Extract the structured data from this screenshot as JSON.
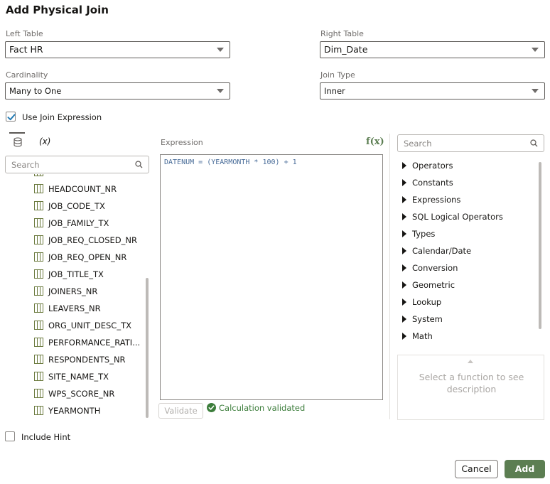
{
  "dialog": {
    "title": "Add Physical Join"
  },
  "left_table": {
    "label": "Left Table",
    "value": "Fact HR"
  },
  "right_table": {
    "label": "Right Table",
    "value": "Dim_Date"
  },
  "cardinality": {
    "label": "Cardinality",
    "value": "Many to One"
  },
  "join_type": {
    "label": "Join Type",
    "value": "Inner"
  },
  "use_join_expression": {
    "label": "Use Join Expression",
    "checked": true
  },
  "left_panel": {
    "variables_tab_label": "(x)",
    "search_placeholder": "Search",
    "columns": [
      "HEADCOUNT_NR",
      "JOB_CODE_TX",
      "JOB_FAMILY_TX",
      "JOB_REQ_CLOSED_NR",
      "JOB_REQ_OPEN_NR",
      "JOB_TITLE_TX",
      "JOINERS_NR",
      "LEAVERS_NR",
      "ORG_UNIT_DESC_TX",
      "PERFORMANCE_RATI...",
      "RESPONDENTS_NR",
      "SITE_NAME_TX",
      "WPS_SCORE_NR",
      "YEARMONTH"
    ]
  },
  "expression": {
    "label": "Expression",
    "fx_label": "f(x)",
    "text": "DATENUM = (YEARMONTH * 100) + 1",
    "validate_label": "Validate",
    "validated_message": "Calculation validated"
  },
  "functions_panel": {
    "search_placeholder": "Search",
    "categories": [
      "Operators",
      "Constants",
      "Expressions",
      "SQL Logical Operators",
      "Types",
      "Calendar/Date",
      "Conversion",
      "Geometric",
      "Lookup",
      "System",
      "Math"
    ],
    "description_placeholder": "Select a function to see description"
  },
  "include_hint": {
    "label": "Include Hint",
    "checked": false
  },
  "footer": {
    "cancel_label": "Cancel",
    "add_label": "Add"
  },
  "colors": {
    "accent_green": "#5c7e52",
    "validated_green": "#3c7d3b",
    "checkbox_blue": "#227ab3",
    "expression_text": "#4a6d99"
  }
}
